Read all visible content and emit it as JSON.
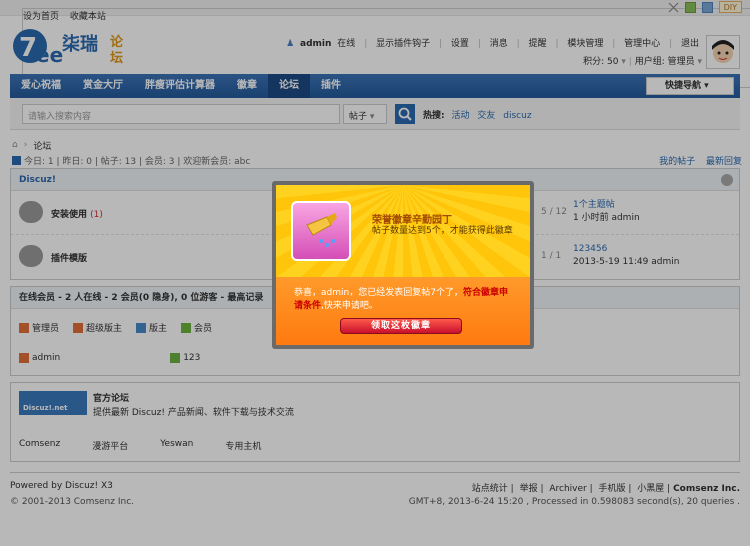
{
  "topbar": {
    "links": [
      "设为首页",
      "收藏本站"
    ],
    "diy_label": "DIY"
  },
  "header": {
    "username": "admin",
    "online_status": "在线",
    "menu": [
      "显示插件钩子",
      "设置",
      "消息",
      "提醒",
      "模块管理",
      "管理中心",
      "退出"
    ],
    "credits": "积分: 50",
    "usergroup": "用户组: 管理员"
  },
  "nav": {
    "items": [
      "爱心祝福",
      "赏金大厅",
      "胖瘦评估计算器",
      "徽章",
      "论坛",
      "插件"
    ],
    "active_index": 4,
    "quick_nav": "快捷导航"
  },
  "search": {
    "placeholder": "请输入搜索内容",
    "type": "帖子",
    "hot_label": "热搜:",
    "hot_terms": [
      "活动",
      "交友",
      "discuz"
    ]
  },
  "breadcrumb": {
    "current": "论坛"
  },
  "stats": {
    "text": "今日: 1 | 昨日: 0 | 帖子: 13 | 会员: 3 | 欢迎新会员: abc",
    "my_posts": "我的帖子",
    "latest_reply": "最新回复"
  },
  "forum_group": {
    "title": "Discuz!",
    "forums": [
      {
        "name": "安装使用",
        "today": "(1)",
        "count": "5 / 12",
        "last_title": "1个主题帖",
        "last_meta": "1 小时前 admin"
      },
      {
        "name": "插件模版",
        "today": "",
        "count": "1 / 1",
        "last_title": "123456",
        "last_meta": "2013-5-19 11:49 admin"
      }
    ]
  },
  "online": {
    "title": "在线会员 - 2 人在线 - 2 会员(0 隐身), 0 位游客 - 最高记录",
    "legend": [
      {
        "label": "管理员",
        "color": "#e0703a"
      },
      {
        "label": "超级版主",
        "color": "#e0703a"
      },
      {
        "label": "版主",
        "color": "#4a8ac9"
      },
      {
        "label": "会员",
        "color": "#6db33f"
      }
    ],
    "users": [
      {
        "name": "admin",
        "color": "#e0703a"
      },
      {
        "name": "123",
        "color": "#6db33f"
      }
    ]
  },
  "friend_links": {
    "banner_text": "Discuz!.net",
    "title": "官方论坛",
    "desc": "提供最新 Discuz! 产品新闻、软件下载与技术交流",
    "links": [
      "Comsenz",
      "漫游平台",
      "Yeswan",
      "专用主机"
    ]
  },
  "footer": {
    "powered": "Powered by Discuz! X3",
    "copyright": "© 2001-2013 Comsenz Inc.",
    "links": [
      "站点统计",
      "举报",
      "Archiver",
      "手机版",
      "小黑屋",
      "Comsenz Inc."
    ],
    "gmt": "GMT+8, 2013-6-24 15:20 , Processed in 0.598083 second(s), 20 queries ."
  },
  "popup": {
    "title": "荣誉徽章辛勤园丁",
    "desc": "帖子数量达到5个，才能获得此徽章",
    "message_prefix": "恭喜，admin，您已经发表回复帖7个了，",
    "message_highlight": "符合徽章申请条件",
    "message_suffix": ",快来申请吧。",
    "claim_button": "领取这枚徽章"
  }
}
